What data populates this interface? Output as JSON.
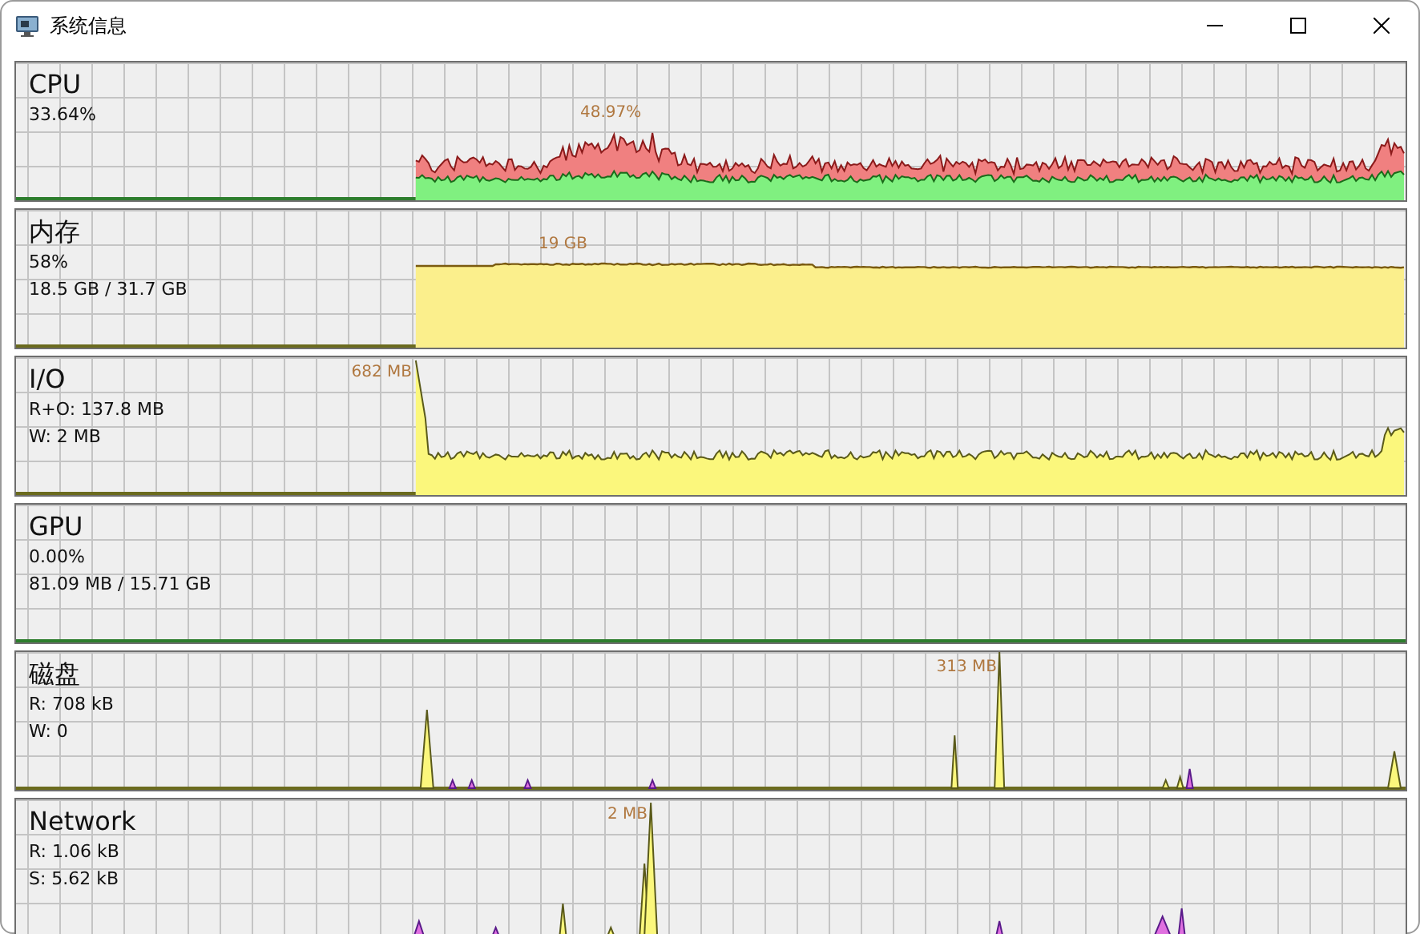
{
  "window": {
    "title": "系统信息"
  },
  "panels": [
    {
      "kind": "cpu",
      "title": "CPU",
      "lines": [
        "33.64%"
      ],
      "peak": "48.97%"
    },
    {
      "kind": "memory",
      "title": "内存",
      "lines": [
        "58%",
        "18.5 GB / 31.7 GB"
      ],
      "peak": "19 GB"
    },
    {
      "kind": "io",
      "title": "I/O",
      "lines": [
        "R+O: 137.8 MB",
        "W: 2 MB"
      ],
      "peak": "682 MB"
    },
    {
      "kind": "gpu",
      "title": "GPU",
      "lines": [
        "0.00%",
        "81.09 MB / 15.71 GB"
      ]
    },
    {
      "kind": "disk",
      "title": "磁盘",
      "lines": [
        "R: 708 kB",
        "W: 0"
      ],
      "peak": "313 MB"
    },
    {
      "kind": "network",
      "title": "Network",
      "lines": [
        "R: 1.06 kB",
        "S: 5.62 kB"
      ],
      "peak": "2 MB"
    }
  ]
}
